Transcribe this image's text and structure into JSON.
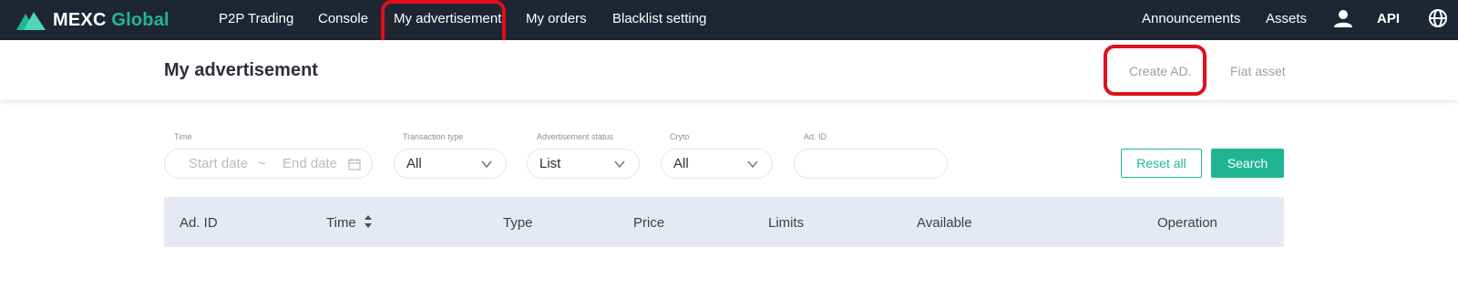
{
  "brand": {
    "name_main": "MEXC",
    "name_accent": "Global",
    "accent_color": "#21b795",
    "nav_bg": "#1e2533"
  },
  "nav": {
    "items": [
      "P2P Trading",
      "Console",
      "My advertisement",
      "My orders",
      "Blacklist setting"
    ],
    "right": [
      "Announcements",
      "Assets",
      "API"
    ],
    "icons": [
      "user-icon",
      "globe-icon"
    ]
  },
  "subheader": {
    "title": "My advertisement",
    "links": [
      "Create AD.",
      "Fiat asset"
    ]
  },
  "filters": {
    "time": {
      "label": "Time",
      "start_placeholder": "Start date",
      "separator": "~",
      "end_placeholder": "End date"
    },
    "transaction_type": {
      "label": "Transaction type",
      "value": "All"
    },
    "advertisement_status": {
      "label": "Advertisement status",
      "value": "List"
    },
    "crypto": {
      "label": "Cryto",
      "value": "All"
    },
    "ad_id": {
      "label": "Ad. ID",
      "value": ""
    },
    "reset_label": "Reset all",
    "search_label": "Search"
  },
  "table": {
    "columns": [
      "Ad. ID",
      "Time",
      "Type",
      "Price",
      "Limits",
      "Available",
      "Operation"
    ]
  },
  "highlight_color": "#e0101a"
}
